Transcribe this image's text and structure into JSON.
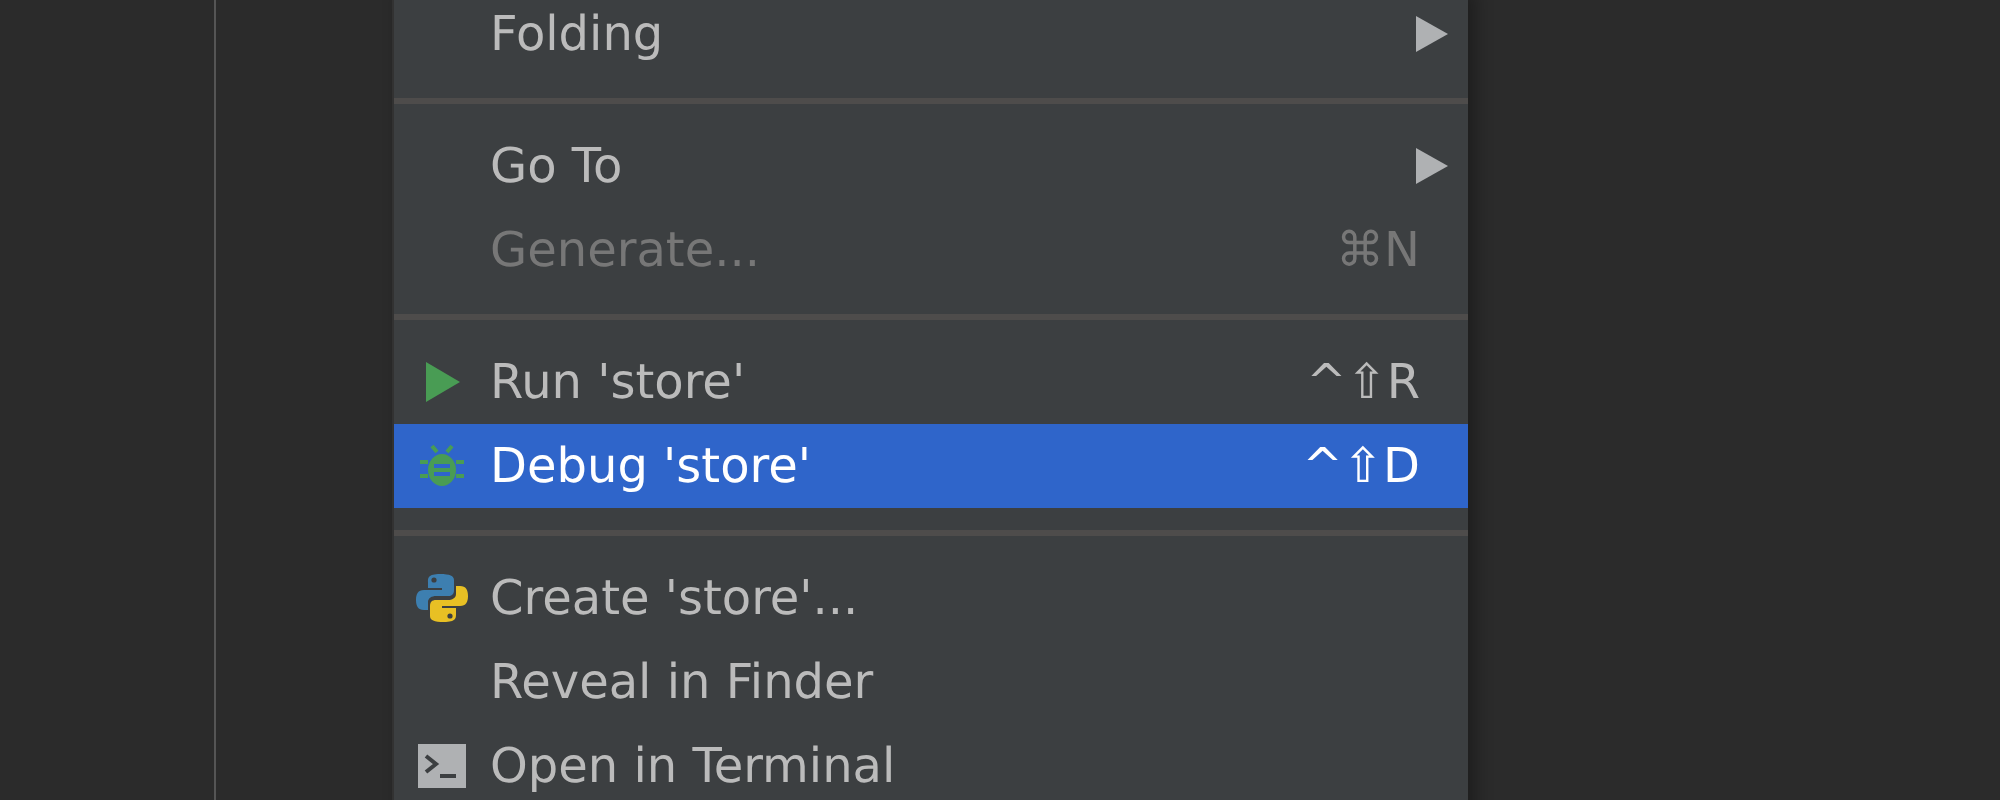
{
  "menu": {
    "items": [
      {
        "kind": "plain",
        "label": "Folding",
        "submenu": true,
        "disabled": false,
        "selected": false
      },
      {
        "kind": "separator"
      },
      {
        "kind": "plain",
        "label": "Go To",
        "submenu": true,
        "disabled": false,
        "selected": false
      },
      {
        "kind": "plain",
        "label": "Generate...",
        "shortcut": "⌘N",
        "disabled": true,
        "selected": false
      },
      {
        "kind": "separator"
      },
      {
        "kind": "run",
        "label": "Run 'store'",
        "shortcut": "^⇧R",
        "disabled": false,
        "selected": false
      },
      {
        "kind": "debug",
        "label": "Debug 'store'",
        "shortcut": "^⇧D",
        "disabled": false,
        "selected": true
      },
      {
        "kind": "separator"
      },
      {
        "kind": "python",
        "label": "Create 'store'...",
        "disabled": false,
        "selected": false
      },
      {
        "kind": "plain",
        "label": "Reveal in Finder",
        "disabled": false,
        "selected": false
      },
      {
        "kind": "terminal",
        "label": "Open in Terminal",
        "disabled": false,
        "selected": false
      }
    ]
  }
}
